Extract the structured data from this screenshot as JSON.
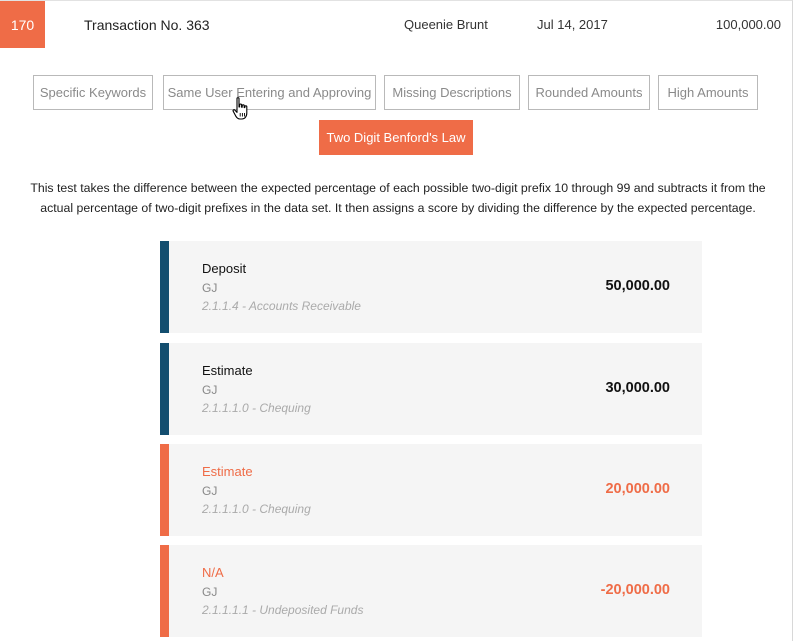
{
  "transaction": {
    "score": "170",
    "title": "Transaction No. 363",
    "user": "Queenie Brunt",
    "date": "Jul 14, 2017",
    "amount": "100,000.00"
  },
  "tests": [
    {
      "label": "Specific Keywords"
    },
    {
      "label": "Same User Entering and Approving"
    },
    {
      "label": "Missing Descriptions"
    },
    {
      "label": "Rounded Amounts"
    },
    {
      "label": "High Amounts"
    }
  ],
  "active_test": {
    "label": "Two Digit Benford's Law"
  },
  "description": "This test takes the difference between the expected percentage of each possible two-digit prefix 10 through 99 and subtracts it from the actual percentage of two-digit prefixes in the data set. It then assigns a score by dividing the difference by the expected percentage.",
  "entries": [
    {
      "name": "Deposit",
      "journal": "GJ",
      "account": "2.1.1.4 - Accounts Receivable",
      "amount": "50,000.00",
      "flagged": false
    },
    {
      "name": "Estimate",
      "journal": "GJ",
      "account": "2.1.1.1.0 - Chequing",
      "amount": "30,000.00",
      "flagged": false
    },
    {
      "name": "Estimate",
      "journal": "GJ",
      "account": "2.1.1.1.0 - Chequing",
      "amount": "20,000.00",
      "flagged": true
    },
    {
      "name": "N/A",
      "journal": "GJ",
      "account": "2.1.1.1.1 - Undeposited Funds",
      "amount": "-20,000.00",
      "flagged": true
    }
  ],
  "colors": {
    "accent": "#ef6c47",
    "debit_bar": "#134e6f"
  },
  "icons": {
    "cursor": "hand-pointer-icon"
  }
}
